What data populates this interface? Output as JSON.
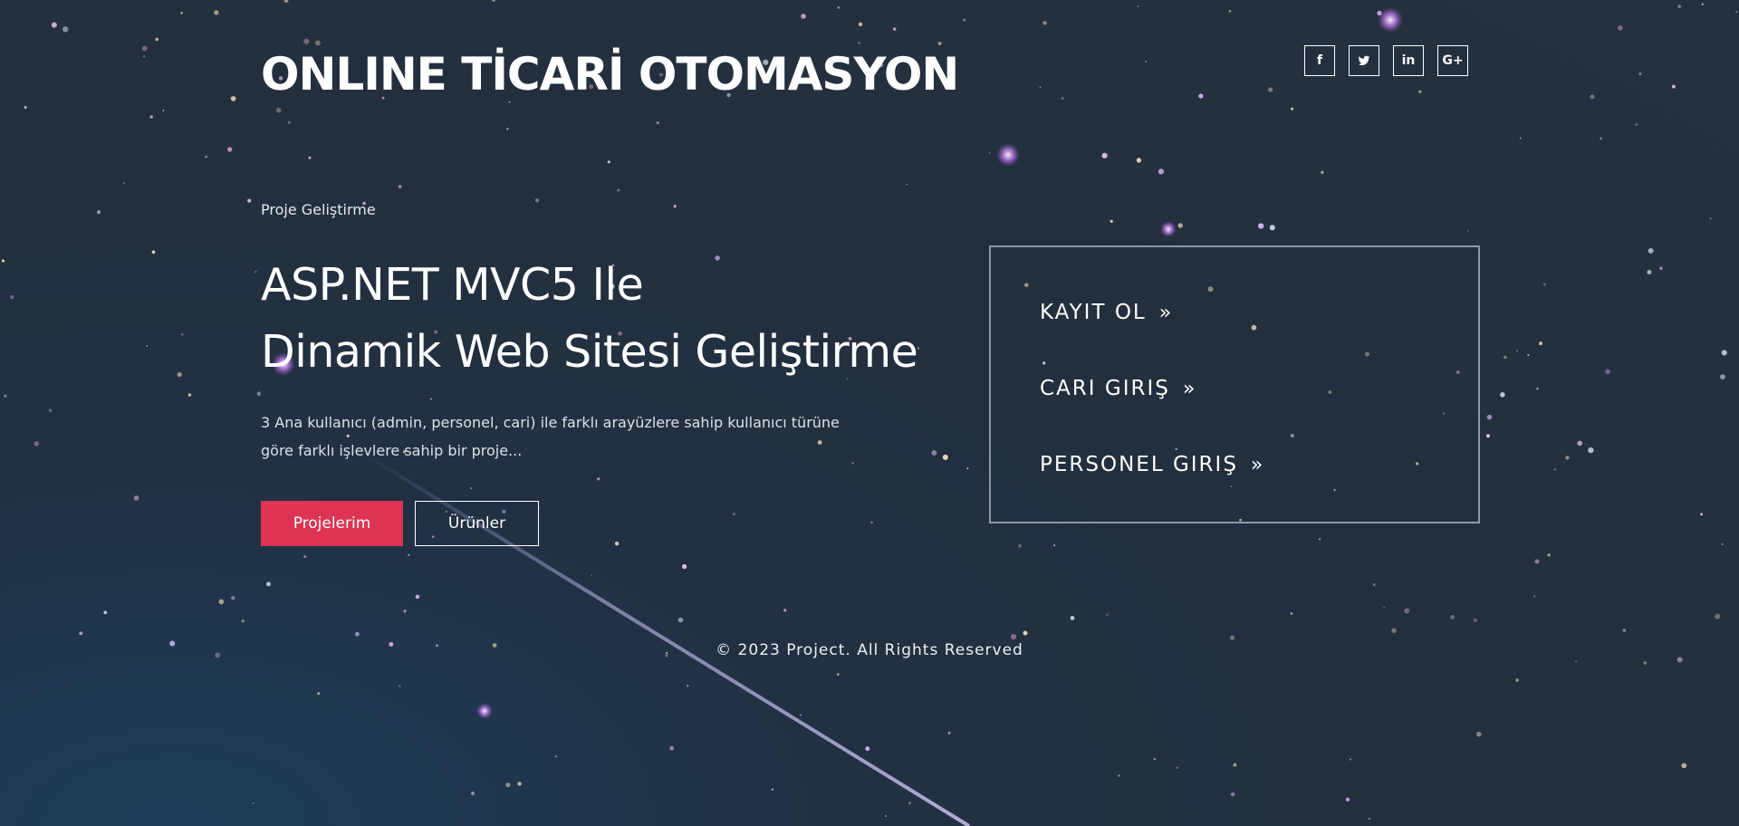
{
  "header": {
    "site_title": "ONLINE TİCARİ OTOMASYON",
    "social_links": [
      {
        "icon": "facebook-icon",
        "glyph": "f"
      },
      {
        "icon": "twitter-icon",
        "glyph": ""
      },
      {
        "icon": "linkedin-icon",
        "glyph": "in"
      },
      {
        "icon": "google-plus-icon",
        "glyph": "G+"
      }
    ]
  },
  "hero": {
    "kicker": "Proje Geliştirme",
    "headline_line1": "ASP.NET MVC5 Ile",
    "headline_line2": "Dinamik Web Sitesi Geliştirme",
    "description_line1": "3 Ana kullanıcı (admin, personel, cari) ile farklı arayüzlere sahip kullanıcı türüne",
    "description_line2": "göre farklı işlevlere sahip bir proje...",
    "primary_button": "Projelerim",
    "secondary_button": "Ürünler"
  },
  "login_box": {
    "items": [
      {
        "label": "KAYIT OL",
        "arrow": "»"
      },
      {
        "label": "CARI GIRIŞ",
        "arrow": "»"
      },
      {
        "label": "PERSONEL GIRIŞ",
        "arrow": "»"
      }
    ]
  },
  "footer": {
    "copyright": "© 2023 Project. All Rights Reserved"
  },
  "colors": {
    "background": "#232f3d",
    "accent": "#dc3452",
    "text": "#ffffff",
    "box_border": "#8f98a3"
  }
}
